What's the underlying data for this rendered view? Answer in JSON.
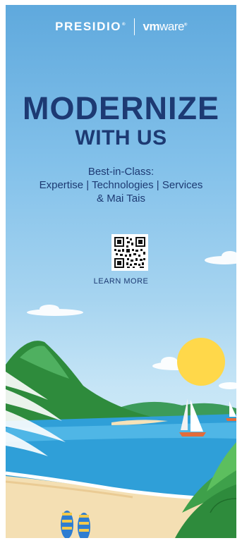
{
  "logos": {
    "presidio": "PRESIDIO",
    "presidio_mark": "®",
    "vmware_bold": "vm",
    "vmware_rest": "ware",
    "vmware_mark": "®"
  },
  "headline": {
    "line1": "MODERNIZE",
    "line2": "WITH US"
  },
  "tagline": {
    "line1": "Best-in-Class:",
    "line2": "Expertise | Technologies | Services",
    "line3": "& Mai Tais"
  },
  "cta": {
    "label": "LEARN MORE"
  },
  "colors": {
    "headline": "#1d3a73",
    "sky_top": "#5fa9dd",
    "sun": "#ffd84a",
    "sea": "#2f9fd8",
    "sand": "#f4dfb3",
    "foliage": "#2e8b3c"
  }
}
